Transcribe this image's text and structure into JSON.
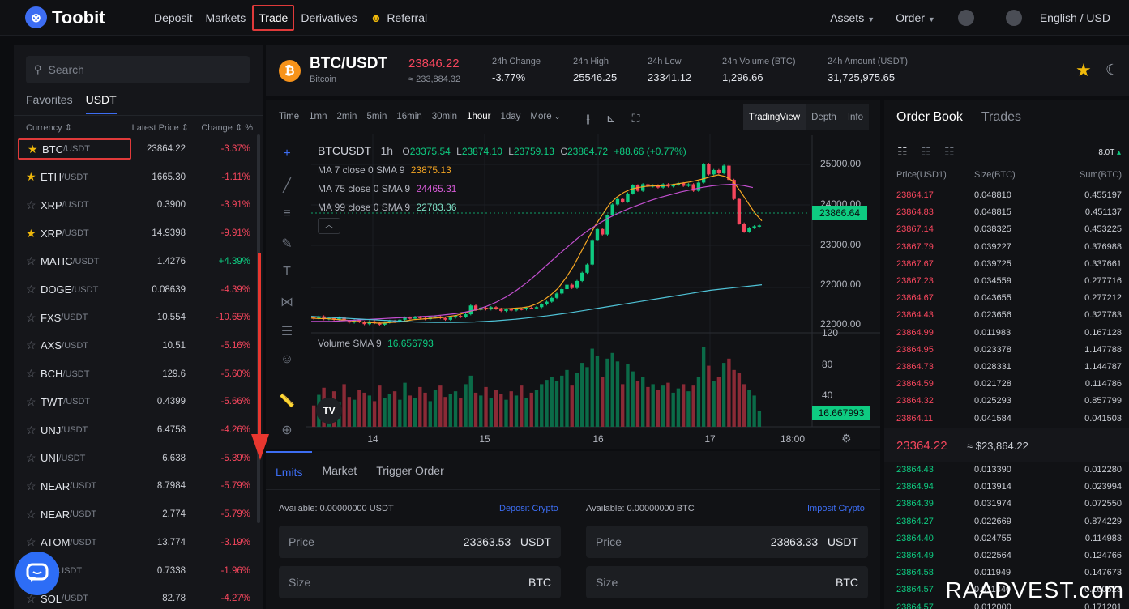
{
  "brand": {
    "logo_glyph": "⊗",
    "name": "Toobit"
  },
  "nav": {
    "items": [
      "Deposit",
      "Markets",
      "Trade",
      "Derivatives",
      "Referral"
    ],
    "active": "Trade",
    "referral_icon": "referral-icon"
  },
  "nav_right": {
    "assets": "Assets",
    "order": "Order",
    "language": "English / USD"
  },
  "search": {
    "placeholder": "Search"
  },
  "market_tabs": [
    "Favorites",
    "USDT"
  ],
  "market_head": {
    "currency": "Currency",
    "latest": "Latest Price",
    "change": "Change",
    "pct": "%"
  },
  "markets": [
    {
      "base": "BTC",
      "quote": "/USDT",
      "price": "23864.22",
      "change": "-3.37%",
      "fav": true,
      "dir": "neg"
    },
    {
      "base": "ETH",
      "quote": "/USDT",
      "price": "1665.30",
      "change": "-1.11%",
      "fav": true,
      "dir": "neg"
    },
    {
      "base": "XRP",
      "quote": "/USDT",
      "price": "0.3900",
      "change": "-3.91%",
      "fav": false,
      "dir": "neg"
    },
    {
      "base": "XRP",
      "quote": "/USDT",
      "price": "14.9398",
      "change": "-9.91%",
      "fav": true,
      "dir": "neg"
    },
    {
      "base": "MATIC",
      "quote": "/USDT",
      "price": "1.4276",
      "change": "+4.39%",
      "fav": false,
      "dir": "pos"
    },
    {
      "base": "DOGE",
      "quote": "/USDT",
      "price": "0.08639",
      "change": "-4.39%",
      "fav": false,
      "dir": "neg"
    },
    {
      "base": "FXS",
      "quote": "/USDT",
      "price": "10.554",
      "change": "-10.65%",
      "fav": false,
      "dir": "neg"
    },
    {
      "base": "AXS",
      "quote": "/USDT",
      "price": "10.51",
      "change": "-5.16%",
      "fav": false,
      "dir": "neg"
    },
    {
      "base": "BCH",
      "quote": "/USDT",
      "price": "129.6",
      "change": "-5.60%",
      "fav": false,
      "dir": "neg"
    },
    {
      "base": "TWT",
      "quote": "/USDT",
      "price": "0.4399",
      "change": "-5.66%",
      "fav": false,
      "dir": "neg"
    },
    {
      "base": "UNJ",
      "quote": "/USDT",
      "price": "6.4758",
      "change": "-4.26%",
      "fav": false,
      "dir": "neg"
    },
    {
      "base": "UNI",
      "quote": "/USDT",
      "price": "6.638",
      "change": "-5.39%",
      "fav": false,
      "dir": "neg"
    },
    {
      "base": "NEAR",
      "quote": "/USDT",
      "price": "8.7984",
      "change": "-5.79%",
      "fav": false,
      "dir": "neg"
    },
    {
      "base": "NEAR",
      "quote": "/USDT",
      "price": "2.774",
      "change": "-5.79%",
      "fav": false,
      "dir": "neg"
    },
    {
      "base": "ATOM",
      "quote": "/USDT",
      "price": "13.774",
      "change": "-3.19%",
      "fav": false,
      "dir": "neg"
    },
    {
      "base": "NA",
      "quote": "/USDT",
      "price": "0.7338",
      "change": "-1.96%",
      "fav": false,
      "dir": "neg"
    },
    {
      "base": "SOL",
      "quote": "/USDT",
      "price": "82.78",
      "change": "-4.27%",
      "fav": false,
      "dir": "neg"
    }
  ],
  "ticker": {
    "coin_glyph": "₿",
    "pair": "BTC/USDT",
    "name": "Bitcoin",
    "last": "23846.22",
    "last_usd": "≈ 233,884.32",
    "stats": [
      {
        "label": "24h Change",
        "value": "-3.77%",
        "dir": "neg"
      },
      {
        "label": "24h High",
        "value": "25546.25",
        "dir": ""
      },
      {
        "label": "24h Low",
        "value": "23341.12",
        "dir": ""
      },
      {
        "label": "24h Volume (BTC)",
        "value": "1,296.66",
        "dir": ""
      },
      {
        "label": "24h Amount (USDT)",
        "value": "31,725,975.65",
        "dir": ""
      }
    ]
  },
  "chart_toolbar": {
    "intervals": [
      "Time",
      "1mn",
      "2min",
      "5min",
      "16min",
      "30min",
      "1hour",
      "1day",
      "More"
    ],
    "active": "1hour",
    "views": [
      "TradingView",
      "Depth",
      "Info"
    ],
    "active_view": "TradingView"
  },
  "chart_legend": {
    "symbol": "BTCUSDT",
    "interval": "1h",
    "ohlc": [
      {
        "k": "O",
        "v": "23375.54"
      },
      {
        "k": "L",
        "v": "23874.10"
      },
      {
        "k": "L",
        "v": "23759.13"
      },
      {
        "k": "C",
        "v": "23864.72"
      }
    ],
    "change": "+88.66 (+0.77%)",
    "ma": [
      {
        "label": "MA 7 close 0 SMA 9",
        "value": "23875.13",
        "color": "#f5a623"
      },
      {
        "label": "MA 75 close 0 SMA 9",
        "value": "24465.31",
        "color": "#d55bd6"
      },
      {
        "label": "MA 99 close 0 SMA 9",
        "value": "22783.36",
        "color": "#4fc3d7"
      }
    ],
    "volume_label": "Volume SMA 9",
    "volume_value": "16.656793"
  },
  "chart_data": {
    "type": "candlestick",
    "x_ticks": [
      "14",
      "15",
      "16",
      "17",
      "18:00"
    ],
    "price_ticks": [
      "25000.00",
      "24000.00",
      "23000.00",
      "22000.00",
      "22000.00"
    ],
    "volume_ticks": [
      "120",
      "80",
      "40"
    ],
    "last_price_label": "23866.64",
    "last_volume_label": "16.667993",
    "ylim": [
      21900,
      25250
    ],
    "candles": [
      [
        22180,
        22160
      ],
      [
        22160,
        22200
      ],
      [
        22200,
        22150
      ],
      [
        22150,
        22170
      ],
      [
        22170,
        22140
      ],
      [
        22140,
        22180
      ],
      [
        22180,
        22120
      ],
      [
        22120,
        22090
      ],
      [
        22090,
        22130
      ],
      [
        22130,
        22100
      ],
      [
        22100,
        22060
      ],
      [
        22060,
        22110
      ],
      [
        22110,
        22080
      ],
      [
        22080,
        22050
      ],
      [
        22050,
        22090
      ],
      [
        22090,
        22120
      ],
      [
        22120,
        22100
      ],
      [
        22100,
        22140
      ],
      [
        22140,
        22180
      ],
      [
        22180,
        22160
      ],
      [
        22160,
        22190
      ],
      [
        22190,
        22170
      ],
      [
        22170,
        22150
      ],
      [
        22150,
        22180
      ],
      [
        22180,
        22200
      ],
      [
        22200,
        22170
      ],
      [
        22170,
        22140
      ],
      [
        22140,
        22180
      ],
      [
        22180,
        22210
      ],
      [
        22210,
        22190
      ],
      [
        22190,
        22240
      ],
      [
        22240,
        22400
      ],
      [
        22400,
        22320
      ],
      [
        22320,
        22360
      ],
      [
        22360,
        22330
      ],
      [
        22330,
        22370
      ],
      [
        22370,
        22340
      ],
      [
        22340,
        22300
      ],
      [
        22300,
        22330
      ],
      [
        22330,
        22310
      ],
      [
        22310,
        22340
      ],
      [
        22340,
        22330
      ],
      [
        22330,
        22360
      ],
      [
        22360,
        22350
      ],
      [
        22350,
        22370
      ],
      [
        22370,
        22420
      ],
      [
        22420,
        22470
      ],
      [
        22470,
        22540
      ],
      [
        22540,
        22620
      ],
      [
        22620,
        22700
      ],
      [
        22700,
        22780
      ],
      [
        22780,
        22720
      ],
      [
        22720,
        22850
      ],
      [
        22850,
        23000
      ],
      [
        23000,
        23150
      ],
      [
        23150,
        23600
      ],
      [
        23600,
        23800
      ],
      [
        23800,
        23700
      ],
      [
        23700,
        24050
      ],
      [
        24050,
        24250
      ],
      [
        24250,
        24350
      ],
      [
        24350,
        24300
      ],
      [
        24300,
        24450
      ],
      [
        24450,
        24600
      ],
      [
        24600,
        24500
      ],
      [
        24500,
        24620
      ],
      [
        24620,
        24580
      ],
      [
        24580,
        24600
      ],
      [
        24600,
        24560
      ],
      [
        24560,
        24620
      ],
      [
        24620,
        24580
      ],
      [
        24580,
        24610
      ],
      [
        24610,
        24640
      ],
      [
        24640,
        24590
      ],
      [
        24590,
        24620
      ],
      [
        24620,
        24500
      ],
      [
        24500,
        24650
      ],
      [
        24650,
        24990
      ],
      [
        24990,
        24800
      ],
      [
        24800,
        24880
      ],
      [
        24880,
        24820
      ],
      [
        24820,
        24960
      ],
      [
        24960,
        24700
      ],
      [
        24700,
        24350
      ],
      [
        24350,
        23900
      ],
      [
        23900,
        23750
      ],
      [
        23750,
        23820
      ],
      [
        23820,
        23850
      ],
      [
        23850,
        23866
      ]
    ],
    "volumes": [
      30,
      45,
      55,
      40,
      50,
      35,
      60,
      42,
      38,
      52,
      48,
      44,
      36,
      58,
      40,
      46,
      50,
      38,
      62,
      44,
      40,
      56,
      48,
      36,
      52,
      58,
      42,
      46,
      50,
      40,
      60,
      72,
      48,
      44,
      56,
      40,
      52,
      46,
      38,
      50,
      44,
      58,
      40,
      48,
      52,
      60,
      66,
      70,
      64,
      72,
      80,
      58,
      76,
      90,
      84,
      110,
      100,
      70,
      96,
      104,
      92,
      60,
      88,
      78,
      64,
      70,
      56,
      60,
      52,
      58,
      62,
      48,
      54,
      60,
      50,
      58,
      70,
      112,
      86,
      64,
      70,
      90,
      96,
      80,
      76,
      60,
      52,
      44,
      22
    ],
    "ma_fast": [
      22170,
      22160,
      22160,
      22150,
      22140,
      22130,
      22110,
      22100,
      22090,
      22080,
      22080,
      22090,
      22100,
      22120,
      22140,
      22150,
      22160,
      22170,
      22180,
      22200,
      22220,
      22260,
      22300,
      22330,
      22340,
      22340,
      22340,
      22340,
      22350,
      22360,
      22380,
      22430,
      22500,
      22600,
      22720,
      22900,
      23100,
      23350,
      23600,
      23850,
      24050,
      24250,
      24380,
      24470,
      24530,
      24560,
      24580,
      24590,
      24590,
      24600,
      24620,
      24640,
      24660,
      24690,
      24720,
      24760,
      24790,
      24760,
      24680,
      24500,
      24300,
      24100,
      23950
    ],
    "ma_mid": [
      22110,
      22110,
      22110,
      22120,
      22130,
      22140,
      22150,
      22160,
      22170,
      22180,
      22190,
      22200,
      22210,
      22230,
      22250,
      22280,
      22320,
      22380,
      22460,
      22560,
      22680,
      22820,
      22980,
      23150,
      23320,
      23480,
      23640,
      23780,
      23900,
      24010,
      24100,
      24180,
      24250,
      24320,
      24380,
      24430,
      24480,
      24520,
      24560,
      24590,
      24610,
      24620,
      24600,
      24560
    ],
    "ma_slow": [
      22200,
      22190,
      22180,
      22170,
      22160,
      22150,
      22140,
      22130,
      22120,
      22110,
      22100,
      22095,
      22090,
      22090,
      22090,
      22095,
      22100,
      22110,
      22120,
      22135,
      22150,
      22170,
      22190,
      22210,
      22235,
      22260,
      22290,
      22320,
      22350,
      22380,
      22410,
      22440,
      22470,
      22500,
      22530,
      22560,
      22590,
      22620,
      22650,
      22680,
      22700,
      22720,
      22740,
      22760,
      22780
    ]
  },
  "trade": {
    "tabs": [
      "Lmits",
      "Market",
      "Trigger Order"
    ],
    "active": "Lmits",
    "buy": {
      "available": "Available: 0.00000000 USDT",
      "link": "Deposit Crypto",
      "price_label": "Price",
      "price": "23363.53",
      "price_unit": "USDT",
      "size_label": "Size",
      "size_unit": "BTC"
    },
    "sell": {
      "available": "Available: 0.00000000 BTC",
      "link": "Imposit Crypto",
      "price_label": "Price",
      "price": "23863.33",
      "price_unit": "USDT",
      "size_label": "Size",
      "size_unit": "BTC"
    }
  },
  "orderbook": {
    "tabs": [
      "Order Book",
      "Trades"
    ],
    "active": "Order Book",
    "precision": "8.0T",
    "head": {
      "price": "Price(USD1)",
      "size": "Size(BTC)",
      "sum": "Sum(BTC)"
    },
    "asks": [
      [
        "23864.17",
        "0.048810",
        "0.455197"
      ],
      [
        "23864.83",
        "0.048815",
        "0.451137"
      ],
      [
        "23867.14",
        "0.038325",
        "0.453225"
      ],
      [
        "23867.79",
        "0.039227",
        "0.376988"
      ],
      [
        "23867.67",
        "0.039725",
        "0.337661"
      ],
      [
        "23867.23",
        "0.034559",
        "0.277716"
      ],
      [
        "23864.67",
        "0.043655",
        "0.277212"
      ],
      [
        "23864.43",
        "0.023656",
        "0.327783"
      ],
      [
        "23864.99",
        "0.011983",
        "0.167128"
      ],
      [
        "23864.95",
        "0.023378",
        "1.147788"
      ],
      [
        "23864.73",
        "0.028331",
        "1.144787"
      ],
      [
        "23864.59",
        "0.021728",
        "0.114786"
      ],
      [
        "23864.32",
        "0.025293",
        "0.857799"
      ],
      [
        "23864.11",
        "0.041584",
        "0.041503"
      ]
    ],
    "mid_price": "23364.22",
    "mid_usd": "≈ $23,864.22",
    "bids": [
      [
        "23864.43",
        "0.013390",
        "0.012280"
      ],
      [
        "23864.94",
        "0.013914",
        "0.023994"
      ],
      [
        "23864.39",
        "0.031974",
        "0.072550"
      ],
      [
        "23864.27",
        "0.022669",
        "0.874229"
      ],
      [
        "23864.40",
        "0.024755",
        "0.114983"
      ],
      [
        "23864.49",
        "0.022564",
        "0.124766"
      ],
      [
        "23864.58",
        "0.011949",
        "0.147673"
      ],
      [
        "23864.57",
        "0.011440",
        "0.160523"
      ],
      [
        "23864.57",
        "0.012000",
        "0.171201"
      ]
    ]
  },
  "watermark": "RAADVEST.com",
  "colors": {
    "accent": "#3d6df2",
    "up": "#0ecb81",
    "down": "#f6465d",
    "highlight": "#e03a3a"
  }
}
